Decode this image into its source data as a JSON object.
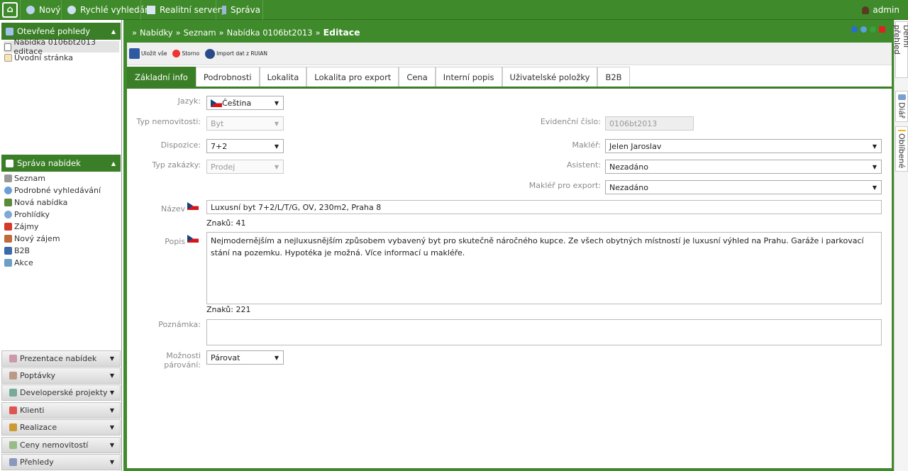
{
  "topnav": {
    "items": [
      "Nový",
      "Rychlé vyhledání",
      "Realitní servery",
      "Správa"
    ],
    "user": "admin"
  },
  "open_views": {
    "title": "Otevřené pohledy",
    "items": [
      "Nabídka 0106bt2013 editace",
      "Úvodní stránka"
    ]
  },
  "offers_mgmt": {
    "title": "Správa nabídek",
    "items": [
      "Seznam",
      "Podrobné vyhledávání",
      "Nová nabídka",
      "Prohlídky",
      "Zájmy",
      "Nový zájem",
      "B2B",
      "Akce"
    ]
  },
  "accordion": [
    "Prezentace nabídek",
    "Poptávky",
    "Developerské projekty",
    "Klienti",
    "Realizace",
    "Ceny nemovitostí",
    "Přehledy"
  ],
  "breadcrumb": {
    "parts": [
      "»",
      "Nabídky",
      "»",
      "Seznam",
      "»",
      "Nabídka 0106bt2013",
      "»"
    ],
    "current": "Editace"
  },
  "toolbar": {
    "save": "Uložit vše",
    "cancel": "Storno",
    "import": "Import dat z RUIAN"
  },
  "tabs": [
    "Základní info",
    "Podrobnosti",
    "Lokalita",
    "Lokalita pro export",
    "Cena",
    "Interní popis",
    "Uživatelské položky",
    "B2B"
  ],
  "form": {
    "jazyk": {
      "label": "Jazyk:",
      "value": "Čeština"
    },
    "typ_nemovitosti": {
      "label": "Typ nemovitosti:",
      "value": "Byt"
    },
    "dispozice": {
      "label": "Dispozice:",
      "value": "7+2"
    },
    "typ_zakazky": {
      "label": "Typ zakázky:",
      "value": "Prodej"
    },
    "evidencni_cislo": {
      "label": "Evidenční číslo:",
      "value": "0106bt2013"
    },
    "makler": {
      "label": "Makléř:",
      "value": "Jelen Jaroslav"
    },
    "asistent": {
      "label": "Asistent:",
      "value": "Nezadáno"
    },
    "makler_export": {
      "label": "Makléř pro export:",
      "value": "Nezadáno"
    },
    "nazev": {
      "label": "Název",
      "value": "Luxusní byt 7+2/L/T/G, OV, 230m2, Praha 8",
      "count": "Znaků: 41"
    },
    "popis": {
      "label": "Popis",
      "value": "Nejmodernějším a nejluxusnějším způsobem vybavený byt pro skutečně náročného kupce. Ze všech obytných místností je luxusní výhled na Prahu. Garáže i parkovací stání na pozemku. Hypotéka je možná. Více informací u makléře.",
      "count": "Znaků: 221"
    },
    "poznamka": {
      "label": "Poznámka:",
      "value": ""
    },
    "parovani": {
      "label1": "Možnosti",
      "label2": "párování:",
      "value": "Párovat"
    }
  },
  "right_tabs": [
    "Denní přehled",
    "Diář",
    "Oblíbené"
  ],
  "colors": {
    "brand": "#3f8a2a",
    "panel_head": "#3a7f27"
  }
}
